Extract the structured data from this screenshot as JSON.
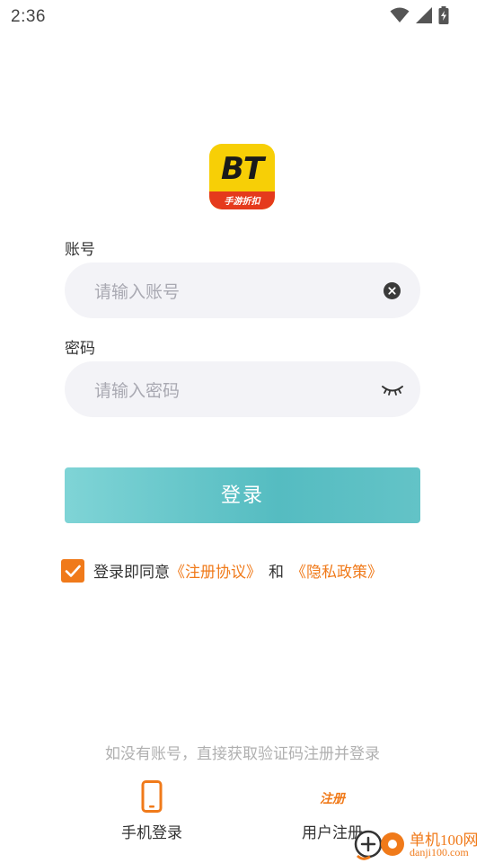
{
  "status_bar": {
    "time": "2:36",
    "icons": [
      "wifi-icon",
      "signal-icon",
      "battery-charging-icon"
    ]
  },
  "logo": {
    "text": "BT",
    "subtitle": "手游折扣"
  },
  "account": {
    "label": "账号",
    "placeholder": "请输入账号",
    "icon": "clear-icon"
  },
  "password": {
    "label": "密码",
    "placeholder": "请输入密码",
    "icon": "eye-closed-icon"
  },
  "login_button": {
    "label": "登录",
    "gradient": [
      "#7fd4d6",
      "#55bcc1"
    ]
  },
  "agreement": {
    "checked": true,
    "prefix": "登录即同意",
    "terms_link": "《注册协议》",
    "and": "和",
    "privacy_link": "《隐私政策》"
  },
  "hint": "如没有账号，直接获取验证码注册并登录",
  "bottom_options": {
    "phone_login": {
      "label": "手机登录",
      "icon": "phone-icon"
    },
    "register": {
      "label": "用户注册",
      "badge": "注册"
    }
  },
  "watermark": {
    "line1": "单机100网",
    "line2": "danji100.com"
  },
  "colors": {
    "accent": "#f07a1a",
    "field_bg": "#f3f3f7",
    "placeholder": "#a9a9b2",
    "logo_yellow": "#f7cf06",
    "logo_red": "#e53a1c"
  }
}
